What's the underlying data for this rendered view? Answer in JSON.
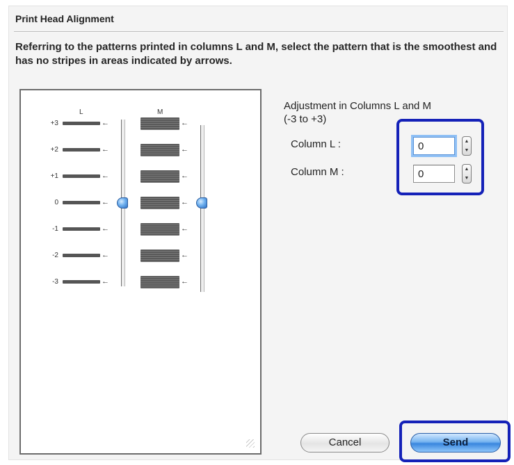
{
  "dialog": {
    "title": "Print Head Alignment",
    "instruction": "Referring to the patterns printed in columns L and M, select the pattern that is the smoothest and has no stripes in areas indicated by arrows."
  },
  "pattern_panel": {
    "column_labels": [
      "L",
      "M"
    ],
    "rows": [
      "+3",
      "+2",
      "+1",
      "0",
      "-1",
      "-2",
      "-3"
    ],
    "arrow_glyph": "←",
    "slider_l_value": 0,
    "slider_m_value": 0
  },
  "adjustment": {
    "title": "Adjustment in Columns L and M",
    "range": "(-3 to +3)",
    "column_l_label": "Column L :",
    "column_l_value": "0",
    "column_m_label": "Column M :",
    "column_m_value": "0"
  },
  "buttons": {
    "cancel": "Cancel",
    "send": "Send"
  },
  "colors": {
    "highlight": "#1421b8",
    "accent_blue": "#3a86de"
  }
}
